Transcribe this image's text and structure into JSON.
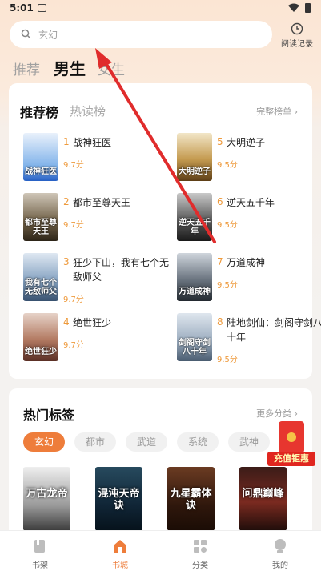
{
  "status_bar": {
    "time": "5:01"
  },
  "search": {
    "placeholder": "玄幻",
    "icon": "search-icon"
  },
  "history": {
    "label": "阅读记录",
    "icon": "clock-icon"
  },
  "tabs": [
    {
      "label": "推荐",
      "active": false
    },
    {
      "label": "男生",
      "active": true
    },
    {
      "label": "女生",
      "active": false
    }
  ],
  "ranking": {
    "tab_active": "推荐榜",
    "tab_other": "热读榜",
    "more": "完整榜单",
    "books": [
      {
        "rank": "1",
        "title": "战神狂医",
        "score": "9.7分",
        "cover_text": "战神狂医"
      },
      {
        "rank": "2",
        "title": "都市至尊天王",
        "score": "9.7分",
        "cover_text": "都市至尊天王"
      },
      {
        "rank": "3",
        "title": "狂少下山，我有七个无敌师父",
        "score": "9.7分",
        "cover_text": "我有七个无敌师父"
      },
      {
        "rank": "4",
        "title": "绝世狂少",
        "score": "9.7分",
        "cover_text": "绝世狂少"
      },
      {
        "rank": "5",
        "title": "大明逆子",
        "score": "9.5分",
        "cover_text": "大明逆子"
      },
      {
        "rank": "6",
        "title": "逆天五千年",
        "score": "9.5分",
        "cover_text": "逆天五千年"
      },
      {
        "rank": "7",
        "title": "万道成神",
        "score": "9.5分",
        "cover_text": "万道成神"
      },
      {
        "rank": "8",
        "title": "陆地剑仙：剑阁守剑八十年",
        "score": "9.5分",
        "cover_text": "剑阁守剑八十年"
      }
    ]
  },
  "hot_tags": {
    "title": "热门标签",
    "more": "更多分类",
    "chips": [
      "玄幻",
      "都市",
      "武道",
      "系统",
      "武神"
    ],
    "covers": [
      "万古龙帝",
      "混沌天帝诀",
      "九星霸体诀",
      "问鼎巅峰"
    ]
  },
  "promo": {
    "label": "充值钜惠"
  },
  "bottom_nav": [
    {
      "label": "书架",
      "icon": "bookshelf-icon",
      "active": false
    },
    {
      "label": "书城",
      "icon": "home-icon",
      "active": true
    },
    {
      "label": "分类",
      "icon": "grid-icon",
      "active": false
    },
    {
      "label": "我的",
      "icon": "profile-icon",
      "active": false
    }
  ],
  "colors": {
    "accent": "#ee7d3b",
    "rank": "#ee9a3c",
    "arrow": "#e02c2c"
  }
}
